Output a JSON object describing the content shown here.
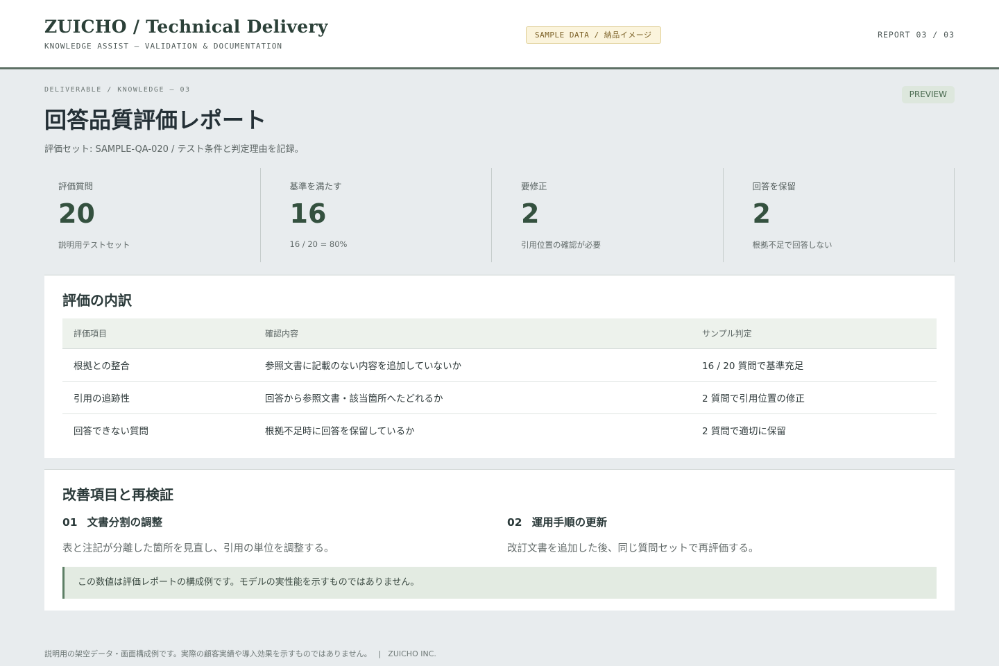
{
  "header": {
    "brand_title": "ZUICHO / Technical Delivery",
    "brand_subtitle": "KNOWLEDGE ASSIST — VALIDATION & DOCUMENTATION",
    "sample_badge": "SAMPLE DATA / 納品イメージ",
    "report_no": "REPORT 03 / 03"
  },
  "page": {
    "eyebrow": "DELIVERABLE / KNOWLEDGE — 03",
    "status_badge": "PREVIEW",
    "title": "回答品質評価レポート",
    "description": "評価セット: SAMPLE-QA-020 / テスト条件と判定理由を記録。"
  },
  "stats": [
    {
      "label": "評価質問",
      "value": "20",
      "note": "説明用テストセット"
    },
    {
      "label": "基準を満たす",
      "value": "16",
      "note": "16 / 20 = 80%"
    },
    {
      "label": "要修正",
      "value": "2",
      "note": "引用位置の確認が必要"
    },
    {
      "label": "回答を保留",
      "value": "2",
      "note": "根拠不足で回答しない"
    }
  ],
  "breakdown": {
    "title": "評価の内訳",
    "columns": [
      "評価項目",
      "確認内容",
      "サンプル判定"
    ],
    "rows": [
      [
        "根拠との整合",
        "参照文書に記載のない内容を追加していないか",
        "16 / 20 質問で基準充足"
      ],
      [
        "引用の追跡性",
        "回答から参照文書・該当箇所へたどれるか",
        "2 質問で引用位置の修正"
      ],
      [
        "回答できない質問",
        "根拠不足時に回答を保留しているか",
        "2 質問で適切に保留"
      ]
    ]
  },
  "improvements": {
    "title": "改善項目と再検証",
    "items": [
      {
        "num": "01",
        "title": "文書分割の調整",
        "desc": "表と注記が分離した箇所を見直し、引用の単位を調整する。"
      },
      {
        "num": "02",
        "title": "運用手順の更新",
        "desc": "改訂文書を追加した後、同じ質問セットで再評価する。"
      }
    ],
    "note": "この数値は評価レポートの構成例です。モデルの実性能を示すものではありません。"
  },
  "footer": {
    "disclaimer": "説明用の架空データ・画面構成例です。実際の顧客実績や導入効果を示すものではありません。",
    "separator": "|",
    "company": "ZUICHO INC."
  },
  "colors": {
    "accent": "#34513f",
    "header_rule": "#5d7065",
    "background": "#e8ecee",
    "note_bg": "#e3ebe2"
  }
}
